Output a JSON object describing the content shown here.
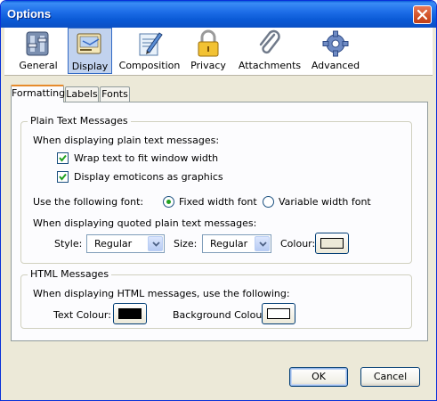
{
  "window": {
    "title": "Options"
  },
  "toolbar": {
    "items": [
      {
        "label": "General",
        "icon": "general-icon"
      },
      {
        "label": "Display",
        "icon": "display-icon",
        "active": true
      },
      {
        "label": "Composition",
        "icon": "composition-icon"
      },
      {
        "label": "Privacy",
        "icon": "lock-icon"
      },
      {
        "label": "Attachments",
        "icon": "paperclip-icon"
      },
      {
        "label": "Advanced",
        "icon": "gear-icon"
      }
    ]
  },
  "tabs": [
    {
      "label": "Formatting",
      "active": true
    },
    {
      "label": "Labels"
    },
    {
      "label": "Fonts"
    }
  ],
  "plain_text": {
    "legend": "Plain Text Messages",
    "when_label": "When displaying plain text messages:",
    "wrap": {
      "label": "Wrap text to fit window width",
      "checked": true
    },
    "emoticons": {
      "label": "Display emoticons as graphics",
      "checked": true
    },
    "font_label": "Use the following font:",
    "font_options": [
      {
        "label": "Fixed width font",
        "selected": true
      },
      {
        "label": "Variable width font",
        "selected": false
      }
    ],
    "quoted_label": "When displaying quoted plain text messages:",
    "style_label": "Style:",
    "style_value": "Regular",
    "size_label": "Size:",
    "size_value": "Regular",
    "colour_label": "Colour:",
    "colour_value": "#ece9d8"
  },
  "html": {
    "legend": "HTML Messages",
    "when_label": "When displaying HTML messages, use the following:",
    "text_colour_label": "Text Colour:",
    "text_colour_value": "#000000",
    "bg_colour_label": "Background Colour:",
    "bg_colour_value": "#ffffff"
  },
  "buttons": {
    "ok": "OK",
    "cancel": "Cancel"
  }
}
